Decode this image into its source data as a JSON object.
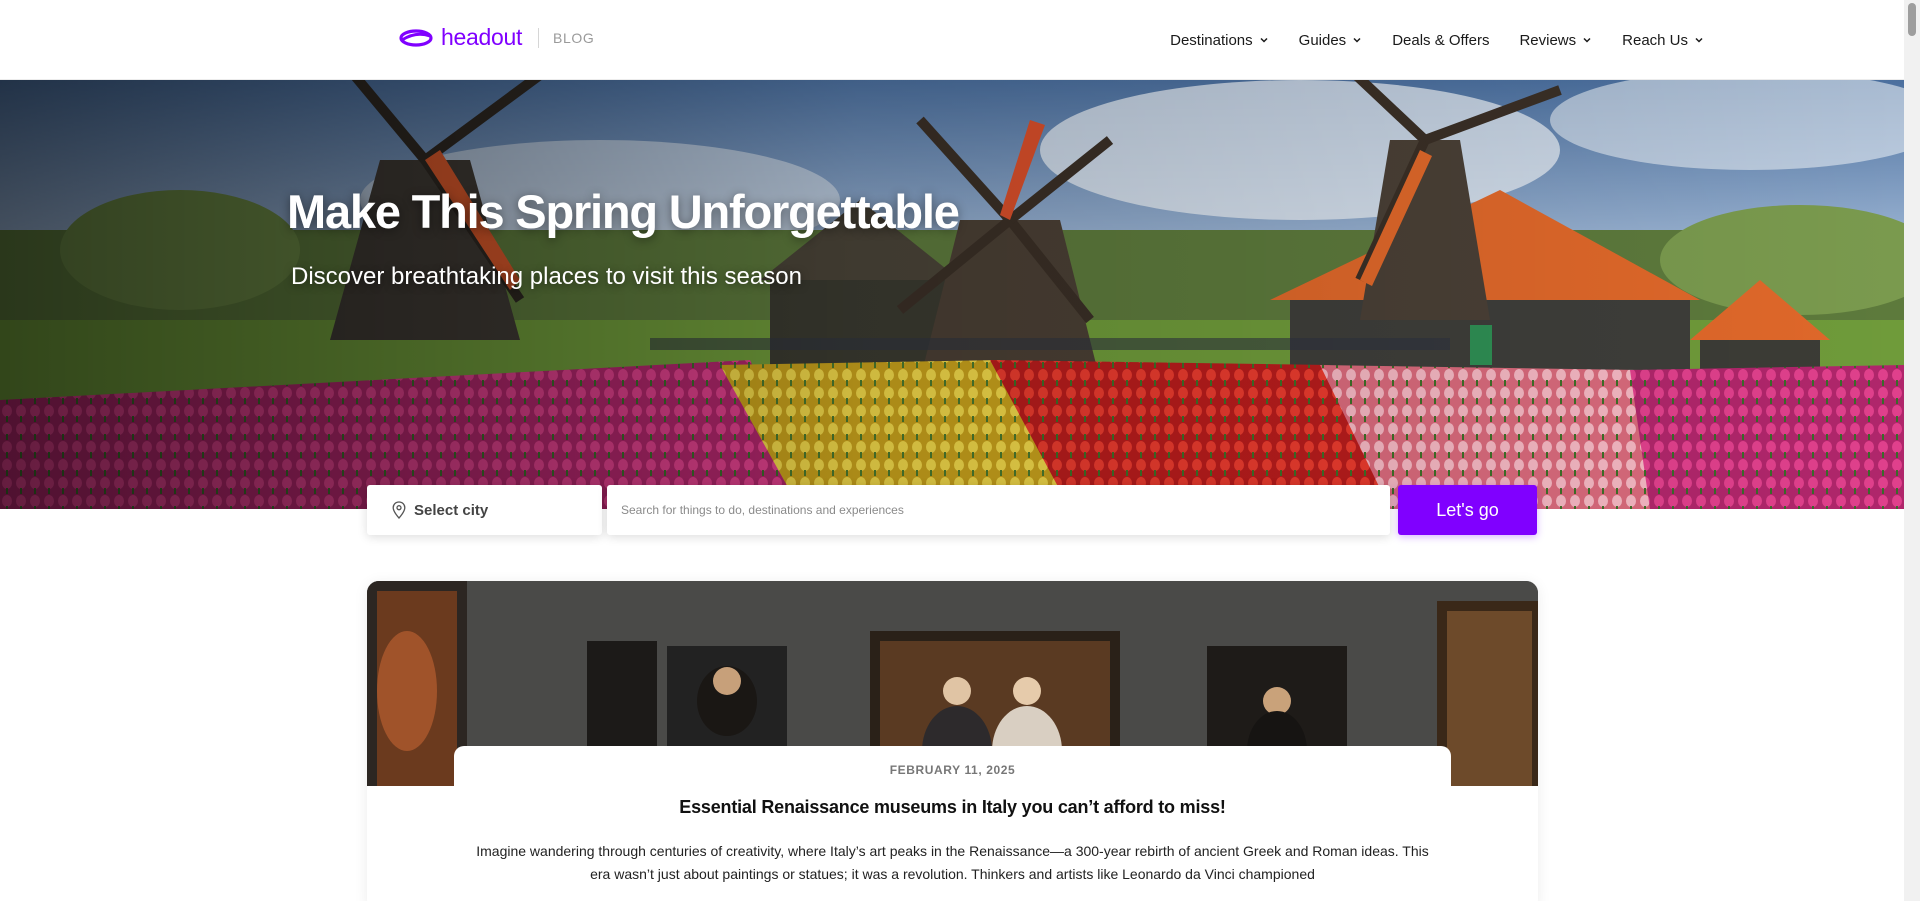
{
  "header": {
    "brand": "headout",
    "brand_sub": "BLOG",
    "nav": [
      {
        "label": "Destinations",
        "has_dropdown": true
      },
      {
        "label": "Guides",
        "has_dropdown": true
      },
      {
        "label": "Deals & Offers",
        "has_dropdown": false
      },
      {
        "label": "Reviews",
        "has_dropdown": true
      },
      {
        "label": "Reach Us",
        "has_dropdown": true
      }
    ]
  },
  "hero": {
    "title": "Make This Spring Unforgettable",
    "subtitle": "Discover breathtaking places to visit this season"
  },
  "search": {
    "city_label": "Select city",
    "placeholder": "Search for things to do, destinations and experiences",
    "button_label": "Let's go"
  },
  "featured": {
    "date": "FEBRUARY 11, 2025",
    "title": "Essential Renaissance museums in Italy you can’t afford to miss!",
    "excerpt": "Imagine wandering through centuries of creativity, where Italy’s art peaks in the Renaissance—a 300-year rebirth of ancient Greek and Roman ideas. This era wasn’t just about paintings or statues; it was a revolution. Thinkers and artists like Leonardo da Vinci championed"
  },
  "colors": {
    "brand": "#8000ff",
    "text": "#1a1a1a"
  },
  "icons": {
    "logo": "headout-logo-icon",
    "dropdown": "chevron-down-icon",
    "location": "map-pin-icon"
  }
}
